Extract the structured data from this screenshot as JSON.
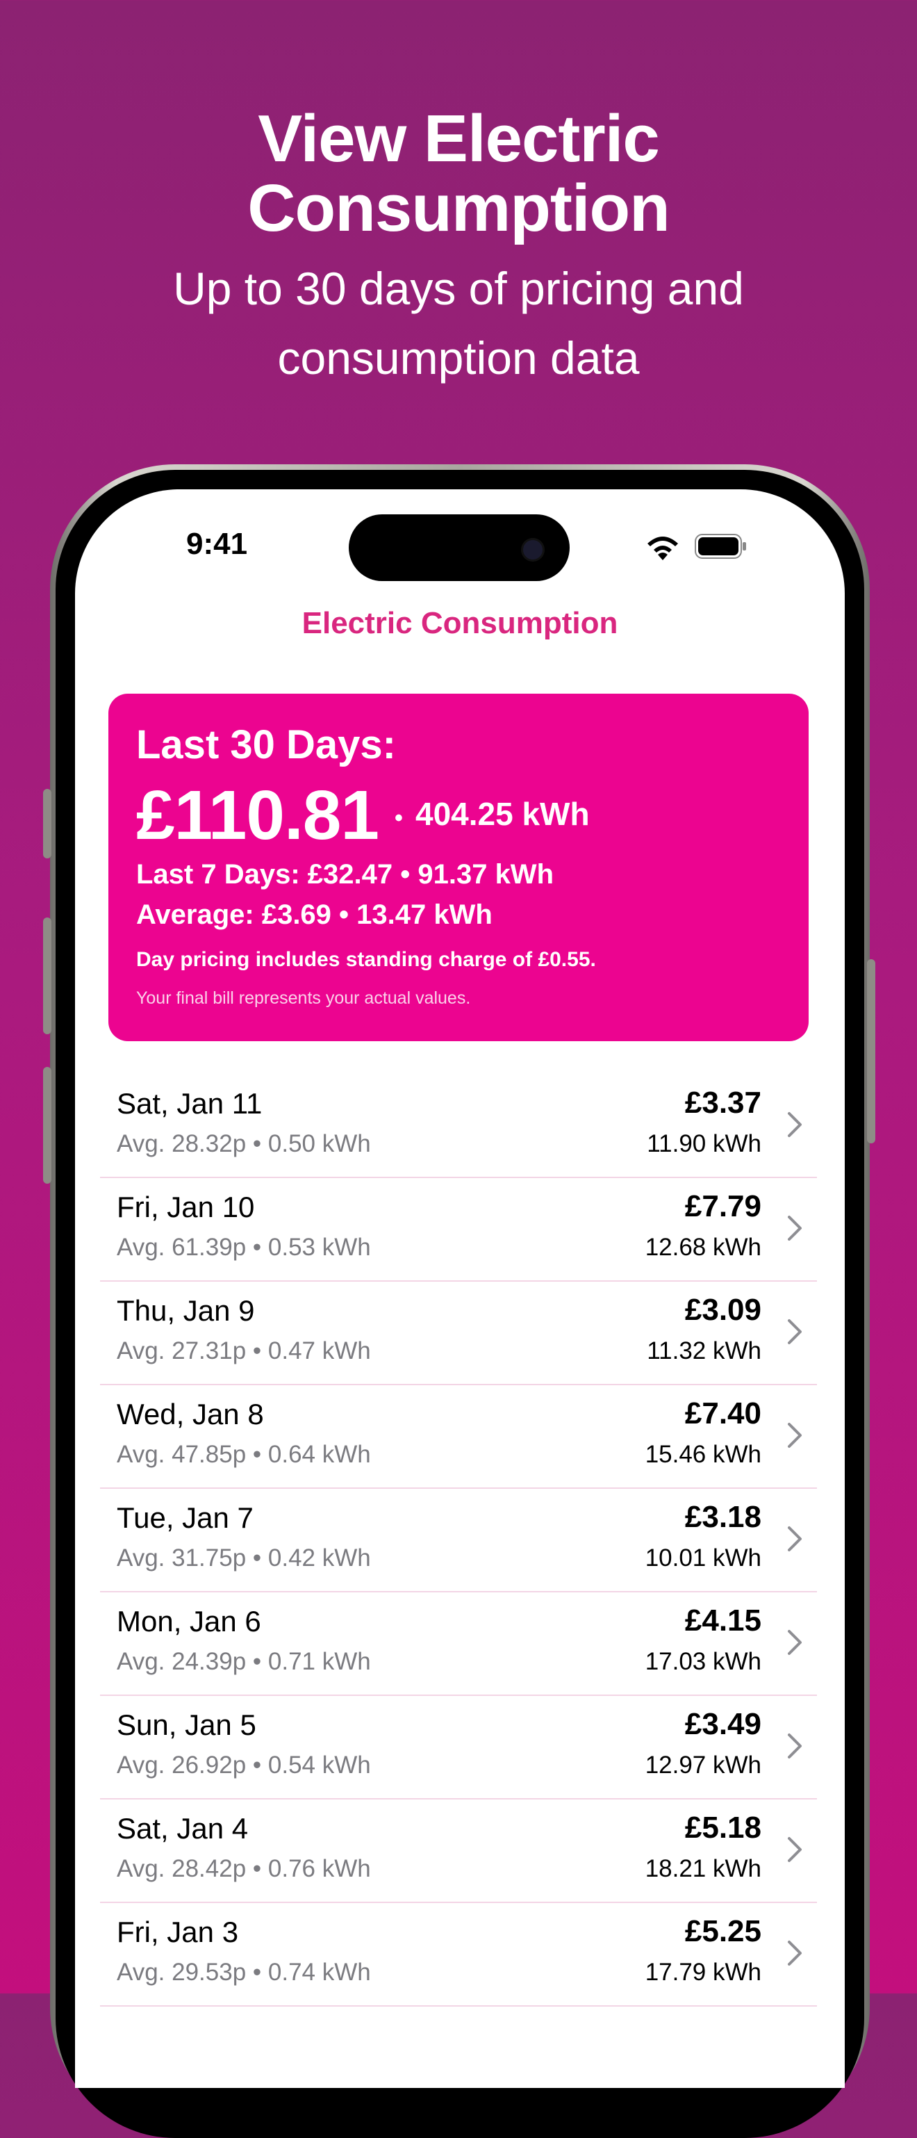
{
  "promo": {
    "title_line1": "View Electric",
    "title_line2": "Consumption",
    "subtitle_line1": "Up to 30 days of pricing and",
    "subtitle_line2": "consumption data"
  },
  "status_bar": {
    "time": "9:41",
    "icons": [
      "wifi-icon",
      "battery-icon"
    ]
  },
  "nav": {
    "title": "Electric Consumption"
  },
  "summary": {
    "heading": "Last 30 Days:",
    "total_cost": "£110.81",
    "separator": "•",
    "total_kwh": "404.25 kWh",
    "last7": "Last 7 Days: £32.47 • 91.37 kWh",
    "average": "Average: £3.69 • 13.47 kWh",
    "standing_note": "Day pricing includes standing charge of £0.55.",
    "bill_note": "Your final bill represents your actual values."
  },
  "days": [
    {
      "date": "Sat, Jan 11",
      "avg": "Avg. 28.32p • 0.50 kWh",
      "cost": "£3.37",
      "kwh": "11.90 kWh"
    },
    {
      "date": "Fri, Jan 10",
      "avg": "Avg. 61.39p • 0.53 kWh",
      "cost": "£7.79",
      "kwh": "12.68 kWh"
    },
    {
      "date": "Thu, Jan 9",
      "avg": "Avg. 27.31p • 0.47 kWh",
      "cost": "£3.09",
      "kwh": "11.32 kWh"
    },
    {
      "date": "Wed, Jan 8",
      "avg": "Avg. 47.85p • 0.64 kWh",
      "cost": "£7.40",
      "kwh": "15.46 kWh"
    },
    {
      "date": "Tue, Jan 7",
      "avg": "Avg. 31.75p • 0.42 kWh",
      "cost": "£3.18",
      "kwh": "10.01 kWh"
    },
    {
      "date": "Mon, Jan 6",
      "avg": "Avg. 24.39p • 0.71 kWh",
      "cost": "£4.15",
      "kwh": "17.03 kWh"
    },
    {
      "date": "Sun, Jan 5",
      "avg": "Avg. 26.92p • 0.54 kWh",
      "cost": "£3.49",
      "kwh": "12.97 kWh"
    },
    {
      "date": "Sat, Jan 4",
      "avg": "Avg. 28.42p • 0.76 kWh",
      "cost": "£5.18",
      "kwh": "18.21 kWh"
    },
    {
      "date": "Fri, Jan 3",
      "avg": "Avg. 29.53p • 0.74 kWh",
      "cost": "£5.25",
      "kwh": "17.79 kWh"
    }
  ],
  "colors": {
    "accent": "#EC0490",
    "title": "#D9267F",
    "background_top": "#8C2272",
    "background_bottom": "#C30F7D"
  }
}
